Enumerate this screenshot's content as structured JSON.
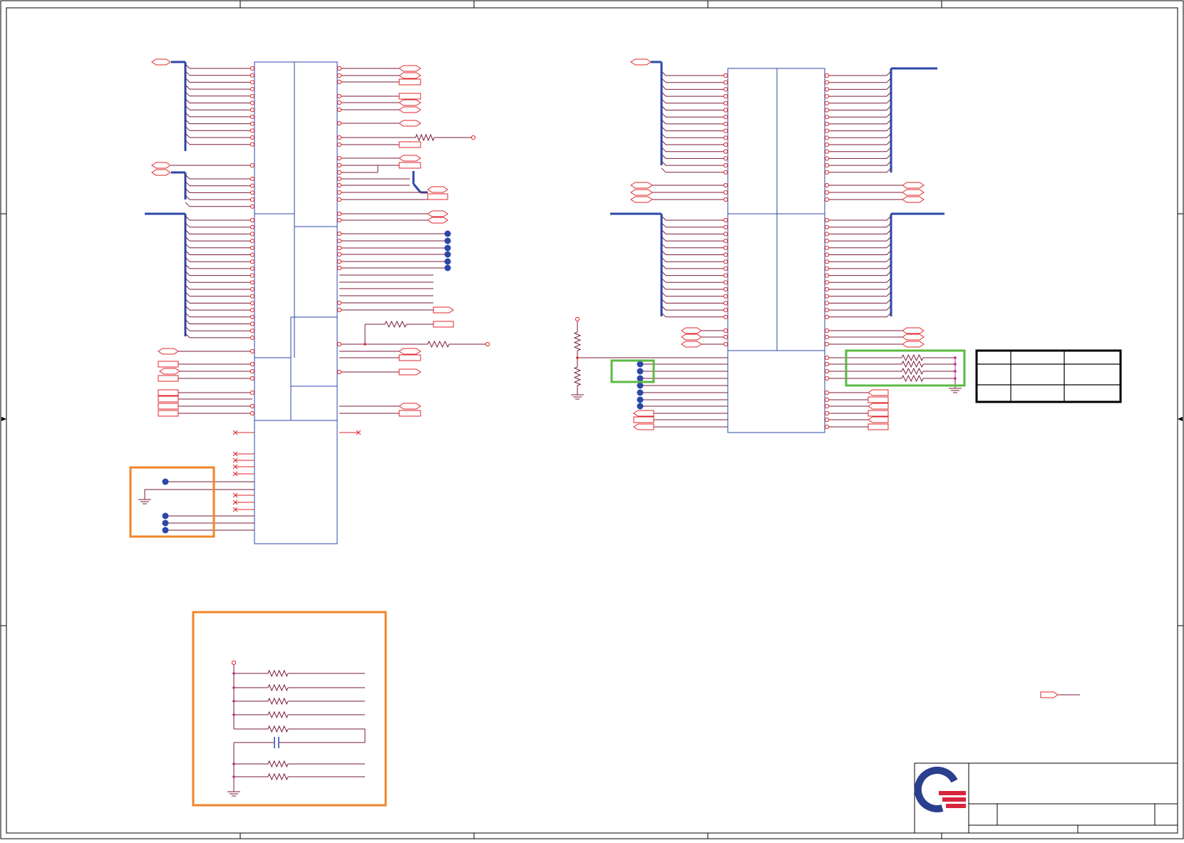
{
  "sheet": {
    "title": "",
    "colors": {
      "border": "#000000",
      "wire_red": "#e0262b",
      "wire_dark": "#7a1b3a",
      "bus_blue": "#2b47a8",
      "component_blue": "#2b47a8",
      "junction": "#2b47a8",
      "highlight_orange": "#f0862a",
      "highlight_green": "#5cb944",
      "resistor_magenta": "#c2238b",
      "logo_blue": "#2b3f8f",
      "logo_red": "#d7263d"
    },
    "icons": [
      "company-logo",
      "ground-symbol",
      "resistor-symbol",
      "capacitor-symbol",
      "net-label-flag",
      "power-pin-circle",
      "no-connect-x",
      "sheet-border-arrow"
    ],
    "title_block": {
      "logo": "company-logo",
      "rows": [
        "",
        "",
        ""
      ]
    },
    "revision_table": {
      "rows": [
        [
          "",
          "",
          ""
        ],
        [
          "",
          "",
          ""
        ],
        [
          "",
          "",
          ""
        ]
      ]
    }
  }
}
